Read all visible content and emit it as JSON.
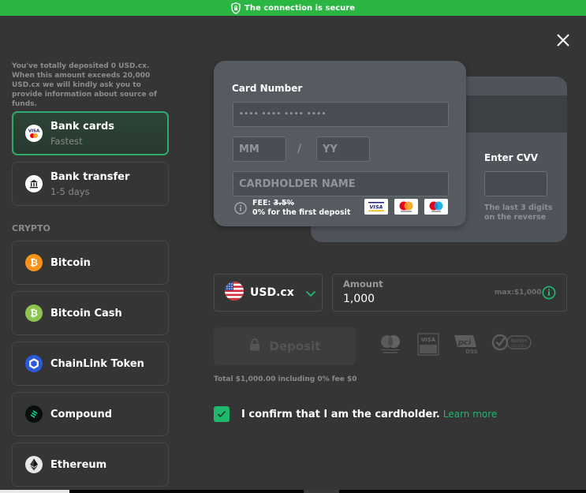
{
  "secure_bar": {
    "text": "The connection is secure",
    "icon": "shield-lock-icon",
    "color": "#2bb543"
  },
  "close": {
    "icon": "close-icon"
  },
  "notice": "You've totally deposited 0 USD.cx. When this amount exceeds 20,000 USD.cx we will kindly ask you to provide information about source of funds.",
  "methods": [
    {
      "title": "Bank cards",
      "subtitle": "Fastest",
      "icon": "visa-mastercard-icon",
      "active": true
    },
    {
      "title": "Bank transfer",
      "subtitle": "1-5 days",
      "icon": "bank-icon",
      "active": false
    }
  ],
  "crypto_label": "CRYPTO",
  "crypto": [
    {
      "title": "Bitcoin",
      "icon": "bitcoin-icon",
      "color": "#f7931a"
    },
    {
      "title": "Bitcoin Cash",
      "icon": "bitcoin-cash-icon",
      "color": "#8dc351"
    },
    {
      "title": "ChainLink Token",
      "icon": "chainlink-icon",
      "color": "#2a5ada"
    },
    {
      "title": "Compound",
      "icon": "compound-icon",
      "color": "#00d395"
    },
    {
      "title": "Ethereum",
      "icon": "ethereum-icon",
      "color": "#e5e5e5"
    }
  ],
  "card": {
    "number_label": "Card Number",
    "number_placeholder": "•••• •••• •••• ••••",
    "mm_placeholder": "MM",
    "separator": "/",
    "yy_placeholder": "YY",
    "name_placeholder": "CARDHOLDER NAME",
    "fee_label": "FEE:",
    "fee_old": "3.5%",
    "fee_note": "0% for the first deposit",
    "brands": [
      "VISA",
      "Mastercard",
      "Maestro"
    ],
    "cvv_label": "Enter CVV",
    "cvv_hint_line1": "The last 3 digits",
    "cvv_hint_line2": "on the reverse"
  },
  "currency": {
    "code": "USD.cx",
    "flag": "us-flag-icon"
  },
  "amount": {
    "label": "Amount",
    "value": "1,000",
    "max": "max:$1,000"
  },
  "deposit": {
    "label": "Deposit",
    "enabled": false
  },
  "trust_badges": [
    "Mastercard ID Check",
    "Verified by VISA",
    "PCI DSS",
    "Norton Secured"
  ],
  "total": "Total $1,000.00 including 0% fee $0",
  "confirm": {
    "text": "I confirm that I am the cardholder.",
    "link": "Learn more",
    "checked": true
  },
  "colors": {
    "accent": "#1fb96e",
    "background": "#353535",
    "card_front": "#565b61",
    "card_back": "#4f545a"
  }
}
